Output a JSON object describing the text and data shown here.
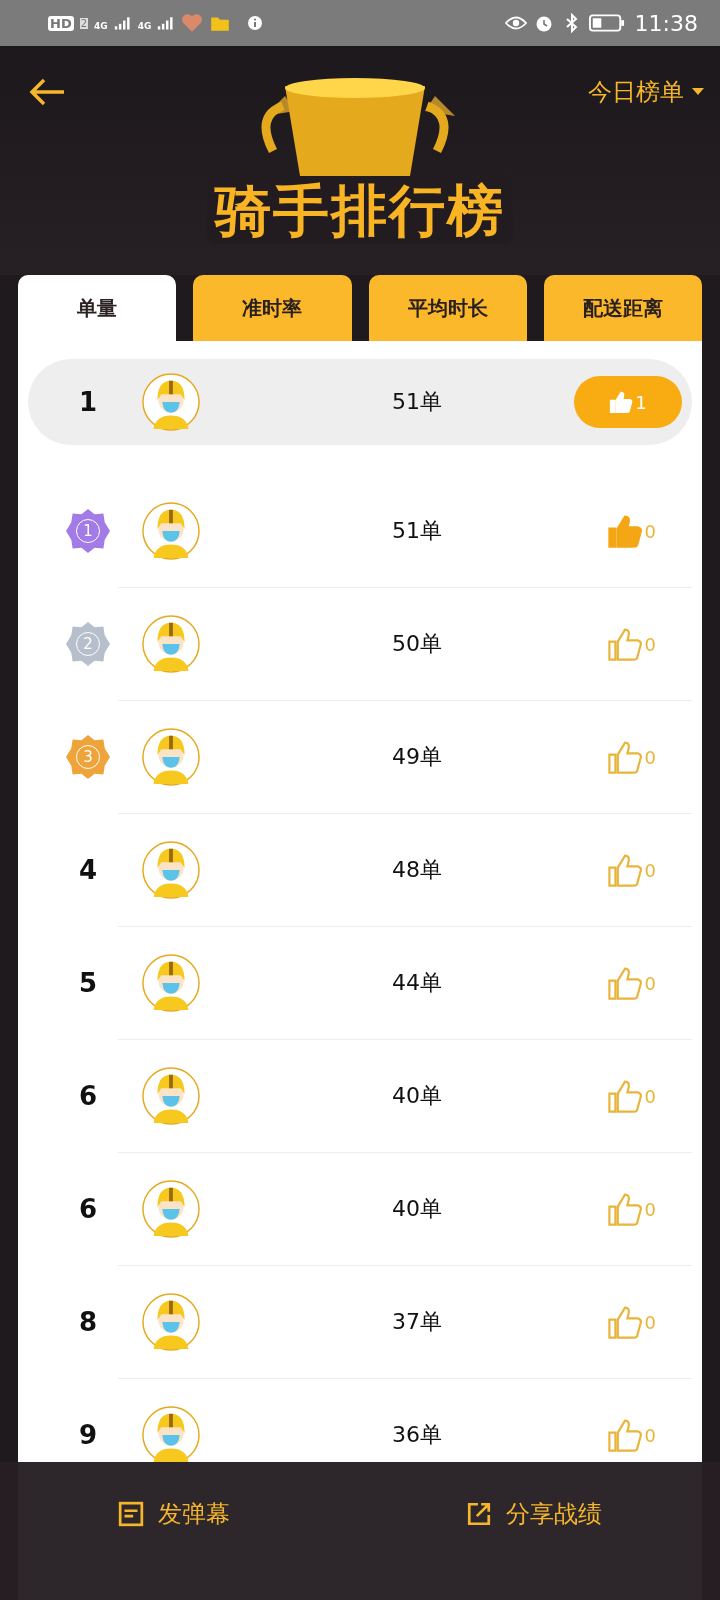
{
  "status_bar": {
    "time": "11:38",
    "hd": "HD",
    "sim": "2",
    "net_1": "4G",
    "net_2": "4G"
  },
  "header": {
    "filter": "今日榜单",
    "title": "骑手排行榜"
  },
  "tabs": [
    {
      "label": "单量",
      "selected": true
    },
    {
      "label": "准时率",
      "selected": false
    },
    {
      "label": "平均时长",
      "selected": false
    },
    {
      "label": "配送距离",
      "selected": false
    }
  ],
  "rows": [
    {
      "kind": "number",
      "rank": "1",
      "count": "51单",
      "likes": "1",
      "liked": true,
      "highlighted": true
    },
    {
      "kind": "medal",
      "rank": "1",
      "color": "#a27be6",
      "count": "51单",
      "likes": "0",
      "liked": true,
      "highlighted": false
    },
    {
      "kind": "medal",
      "rank": "2",
      "color": "#b7bfcc",
      "count": "50单",
      "likes": "0",
      "liked": false,
      "highlighted": false
    },
    {
      "kind": "medal",
      "rank": "3",
      "color": "#eea43a",
      "count": "49单",
      "likes": "0",
      "liked": false,
      "highlighted": false
    },
    {
      "kind": "number",
      "rank": "4",
      "count": "48单",
      "likes": "0",
      "liked": false,
      "highlighted": false
    },
    {
      "kind": "number",
      "rank": "5",
      "count": "44单",
      "likes": "0",
      "liked": false,
      "highlighted": false
    },
    {
      "kind": "number",
      "rank": "6",
      "count": "40单",
      "likes": "0",
      "liked": false,
      "highlighted": false
    },
    {
      "kind": "number",
      "rank": "6",
      "count": "40单",
      "likes": "0",
      "liked": false,
      "highlighted": false
    },
    {
      "kind": "number",
      "rank": "8",
      "count": "37单",
      "likes": "0",
      "liked": false,
      "highlighted": false
    },
    {
      "kind": "number",
      "rank": "9",
      "count": "36单",
      "likes": "0",
      "liked": false,
      "highlighted": false
    }
  ],
  "bottom_bar": {
    "danmaku": "发弹幕",
    "share": "分享战绩"
  }
}
